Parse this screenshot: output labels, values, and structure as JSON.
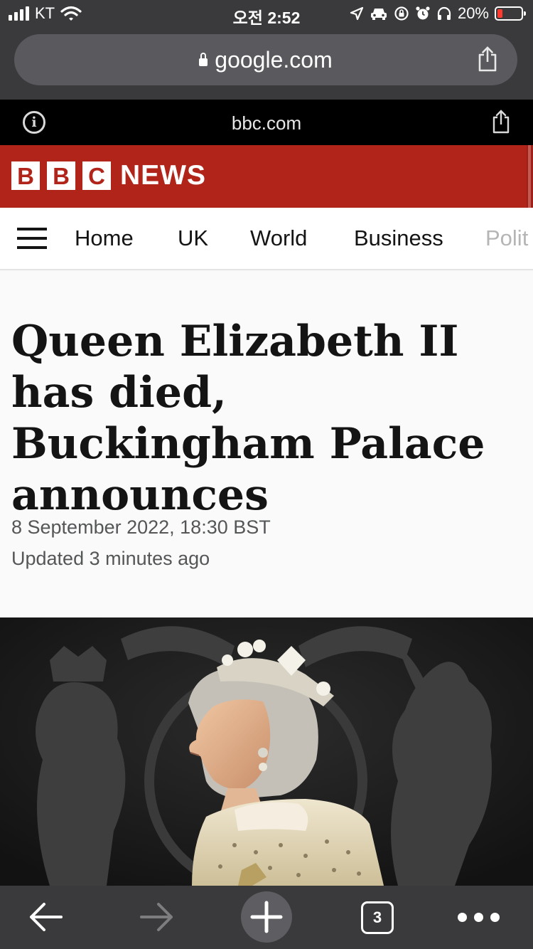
{
  "status_bar": {
    "carrier": "KT",
    "time": "오전 2:52",
    "battery_percent": "20%"
  },
  "browser": {
    "url": "google.com"
  },
  "amp_header": {
    "domain": "bbc.com"
  },
  "bbc": {
    "letters": [
      "B",
      "B",
      "C"
    ],
    "brand": "NEWS",
    "brand_color": "#b0241a"
  },
  "nav": {
    "items": [
      "Home",
      "UK",
      "World",
      "Business",
      "Polit"
    ]
  },
  "article": {
    "headline": "Queen Elizabeth II has died, Buckingham Palace announces",
    "date": "8 September 2022, 18:30 BST",
    "updated": "Updated 3 minutes ago"
  },
  "toolbar": {
    "tab_count": "3"
  },
  "icons": [
    "signal-icon",
    "wifi-icon",
    "location-icon",
    "car-icon",
    "rotation-lock-icon",
    "alarm-icon",
    "headphones-icon",
    "battery-icon",
    "lock-icon",
    "share-icon",
    "info-icon",
    "hamburger-icon",
    "back-arrow-icon",
    "forward-arrow-icon",
    "plus-icon",
    "tabs-icon",
    "more-icon"
  ]
}
